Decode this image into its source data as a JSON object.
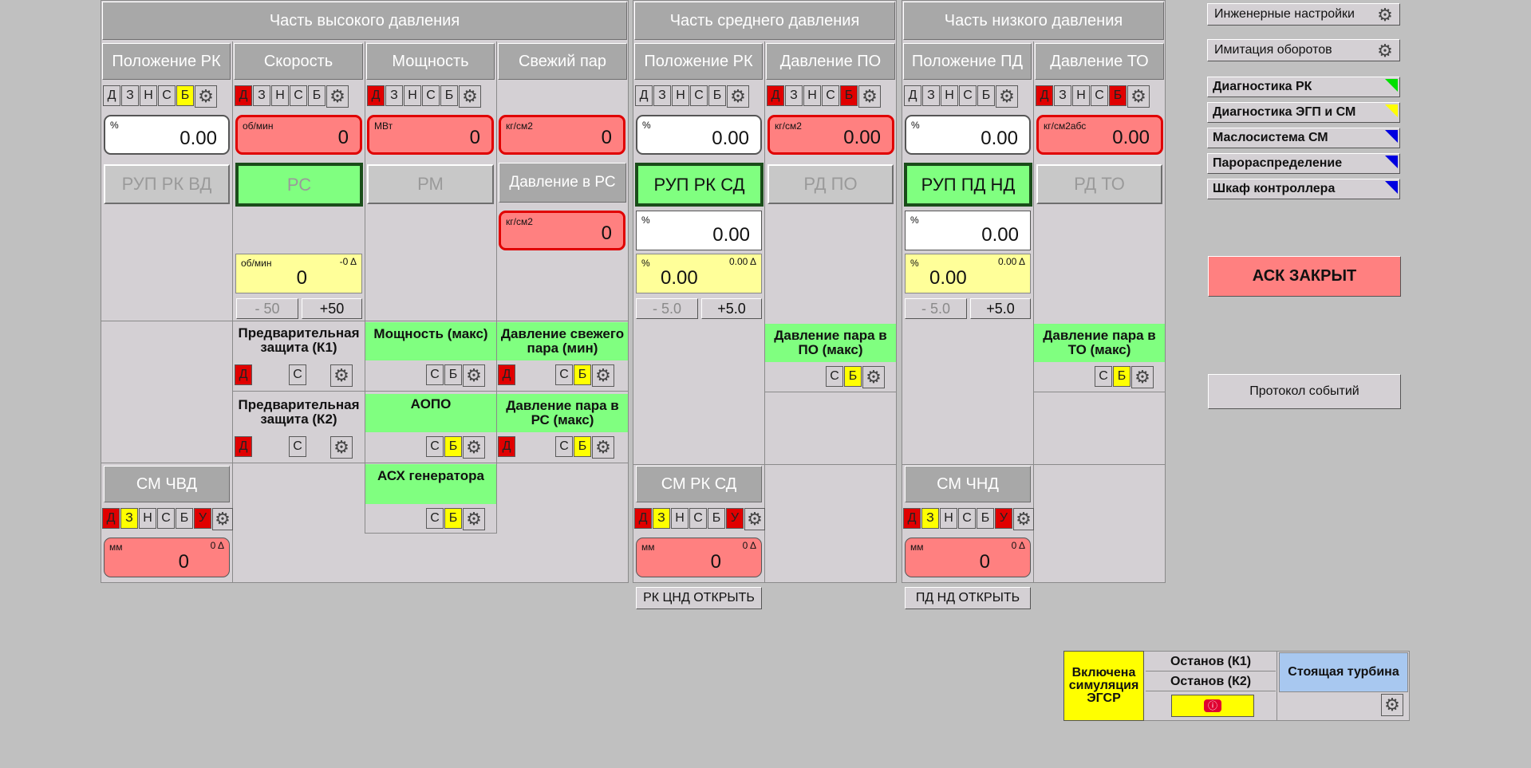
{
  "hp": {
    "title": "Часть высокого давления",
    "cols": [
      "Положение РК",
      "Скорость",
      "Мощность",
      "Свежий пар"
    ],
    "modes1": [
      "Д",
      "З",
      "Н",
      "С",
      "Б"
    ],
    "disp_rk": {
      "unit": "%",
      "value": "0.00"
    },
    "disp_speed": {
      "unit": "об/мин",
      "value": "0"
    },
    "disp_power": {
      "unit": "МВт",
      "value": "0"
    },
    "disp_steam": {
      "unit": "кг/см2",
      "value": "0"
    },
    "btn_rup": "РУП РК ВД",
    "btn_rs": "РС",
    "btn_rm": "РМ",
    "lbl_pressure_rs": "Давление в РС",
    "disp_pressure_rs": {
      "unit": "кг/см2",
      "value": "0"
    },
    "speed_set": {
      "unit": "об/мин",
      "delta": "-0 Δ",
      "value": "0"
    },
    "speed_minus": "- 50",
    "speed_plus": "+50",
    "prot_k1": "Предварительная защита (К1)",
    "prot_power": "Мощность (макс)",
    "prot_steam_min": "Давление свежего пара (мин)",
    "prot_k2": "Предварительная защита (К2)",
    "prot_aopo": "АОПО",
    "prot_rs_max": "Давление пара в РС (макс)",
    "prot_asx": "АСХ генератора",
    "sm_title": "СМ ЧВД",
    "sm_modes": [
      "Д",
      "З",
      "Н",
      "С",
      "Б",
      "У"
    ],
    "sm_disp": {
      "unit": "мм",
      "delta": "0 Δ",
      "value": "0"
    },
    "btn_d": "Д",
    "btn_s": "С",
    "btn_b": "Б"
  },
  "mp": {
    "title": "Часть среднего давления",
    "cols": [
      "Положение РК",
      "Давление ПО"
    ],
    "modes_rk": [
      "Д",
      "З",
      "Н",
      "С",
      "Б"
    ],
    "modes_po": [
      "Д",
      "З",
      "Н",
      "С",
      "Б"
    ],
    "disp_rk": {
      "unit": "%",
      "value": "0.00"
    },
    "disp_po": {
      "unit": "кг/см2",
      "value": "0.00"
    },
    "btn_rup": "РУП РК СД",
    "btn_rd": "РД ПО",
    "disp_pos": {
      "unit": "%",
      "value": "0.00"
    },
    "disp_set": {
      "unit": "%",
      "delta": "0.00 Δ",
      "value": "0.00"
    },
    "minus": "- 5.0",
    "plus": "+5.0",
    "prot_po_max": "Давление пара в ПО (макс)",
    "sm_title": "СМ РК СД",
    "sm_modes": [
      "Д",
      "З",
      "Н",
      "С",
      "Б",
      "У"
    ],
    "sm_disp": {
      "unit": "мм",
      "delta": "0 Δ",
      "value": "0"
    },
    "open_btn": "РК ЦНД ОТКРЫТЬ"
  },
  "lp": {
    "title": "Часть низкого давления",
    "cols": [
      "Положение ПД",
      "Давление ТО"
    ],
    "modes_pd": [
      "Д",
      "З",
      "Н",
      "С",
      "Б"
    ],
    "modes_to": [
      "Д",
      "З",
      "Н",
      "С",
      "Б"
    ],
    "disp_pd": {
      "unit": "%",
      "value": "0.00"
    },
    "disp_to": {
      "unit": "кг/см2абс",
      "value": "0.00"
    },
    "btn_rup": "РУП ПД НД",
    "btn_rd": "РД ТО",
    "disp_pos": {
      "unit": "%",
      "value": "0.00"
    },
    "disp_set": {
      "unit": "%",
      "delta": "0.00 Δ",
      "value": "0.00"
    },
    "minus": "- 5.0",
    "plus": "+5.0",
    "prot_to_max": "Давление пара в ТО (макс)",
    "sm_title": "СМ ЧНД",
    "sm_modes": [
      "Д",
      "З",
      "Н",
      "С",
      "Б",
      "У"
    ],
    "sm_disp": {
      "unit": "мм",
      "delta": "0 Δ",
      "value": "0"
    },
    "open_btn": "ПД НД ОТКРЫТЬ"
  },
  "side": {
    "eng_settings": "Инженерные настройки",
    "rpm_sim": "Имитация оборотов",
    "diag": [
      {
        "label": "Диагностика РК",
        "color": "#00e000"
      },
      {
        "label": "Диагностика ЭГП и СМ",
        "color": "#ffff00"
      },
      {
        "label": "Маслосистема СМ",
        "color": "#0000e0"
      },
      {
        "label": "Парораспределение",
        "color": "#0000e0"
      },
      {
        "label": "Шкаф контроллера",
        "color": "#0000e0"
      }
    ],
    "ask": "АСК ЗАКРЫТ",
    "protocol": "Протокол событий"
  },
  "status": {
    "sim": "Включена симуляция ЭГСР",
    "stop_k1": "Останов (К1)",
    "stop_k2": "Останов (К2)",
    "turbine": "Стоящая турбина"
  },
  "colors": {
    "alarm": "#ff8080",
    "ok": "#80ff80",
    "warn": "#ffff00",
    "info": "#a8c8f0"
  }
}
